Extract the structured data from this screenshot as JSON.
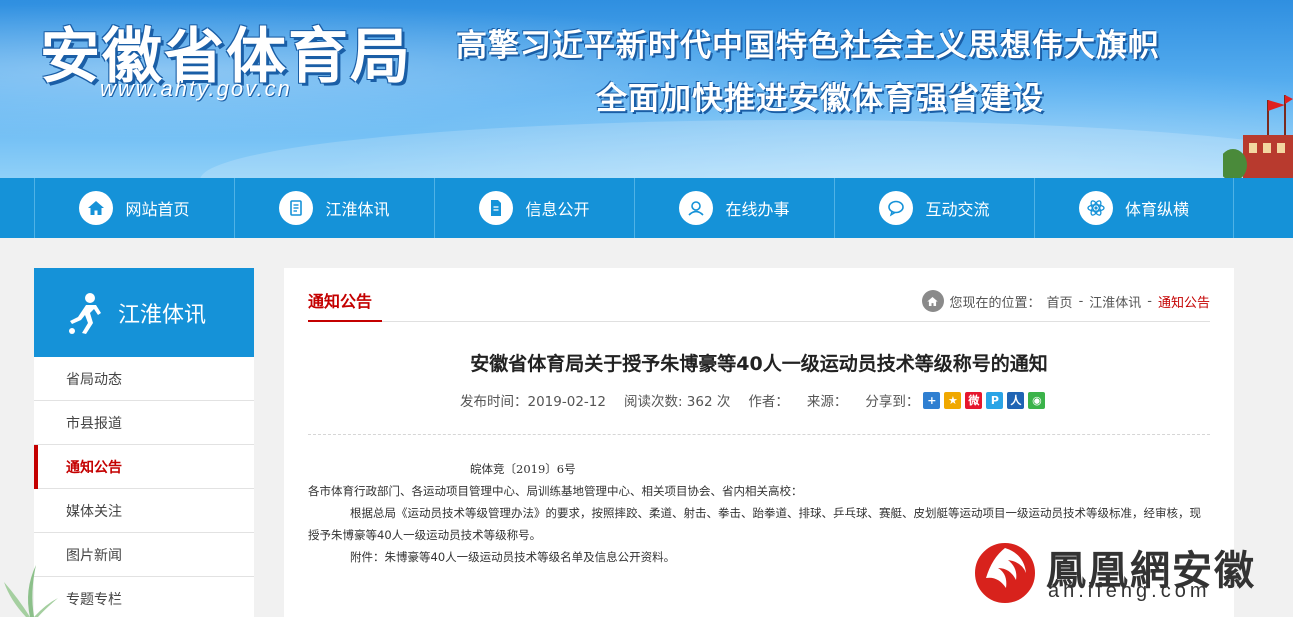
{
  "banner": {
    "site_title": "安徽省体育局",
    "site_url": "www.ahty.gov.cn",
    "slogan_line1": "高擎习近平新时代中国特色社会主义思想伟大旗帜",
    "slogan_line2": "全面加快推进安徽体育强省建设"
  },
  "nav": {
    "items": [
      {
        "label": "网站首页",
        "icon": "home-icon"
      },
      {
        "label": "江淮体讯",
        "icon": "document-icon"
      },
      {
        "label": "信息公开",
        "icon": "file-icon"
      },
      {
        "label": "在线办事",
        "icon": "service-icon"
      },
      {
        "label": "互动交流",
        "icon": "chat-icon"
      },
      {
        "label": "体育纵横",
        "icon": "atom-icon"
      }
    ]
  },
  "sidebar": {
    "title": "江淮体讯",
    "items": [
      {
        "label": "省局动态"
      },
      {
        "label": "市县报道"
      },
      {
        "label": "通知公告",
        "active": true
      },
      {
        "label": "媒体关注"
      },
      {
        "label": "图片新闻"
      },
      {
        "label": "专题专栏"
      }
    ]
  },
  "main": {
    "section_title": "通知公告",
    "breadcrumb": {
      "prefix": "您现在的位置：",
      "home": "首页",
      "sep": "-",
      "level1": "江淮体讯",
      "current": "通知公告"
    },
    "article": {
      "title": "安徽省体育局关于授予朱博豪等40人一级运动员技术等级称号的通知",
      "publish_time": "发布时间：2019-02-12",
      "views": "阅读次数: 362 次",
      "author": "作者：",
      "source": "来源：",
      "share_label": "分享到：",
      "doc_number": "皖体竞〔2019〕6号",
      "recipients": "各市体育行政部门、各运动项目管理中心、局训练基地管理中心、相关项目协会、省内相关高校：",
      "paragraph1": "根据总局《运动员技术等级管理办法》的要求，按照摔跤、柔道、射击、拳击、跆拳道、排球、乒乓球、赛艇、皮划艇等运动项目一级运动员技术等级标准，经审核，现授予朱博豪等40人一级运动员技术等级称号。",
      "attachment": "附件：朱博豪等40人一级运动员技术等级名单及信息公开资料。"
    }
  },
  "share_icons": [
    {
      "name": "qzone-share-icon",
      "color": "#2f7fd1",
      "glyph": "+"
    },
    {
      "name": "qq-share-icon",
      "color": "#f0a800",
      "glyph": "★"
    },
    {
      "name": "weibo-share-icon",
      "color": "#e6162d",
      "glyph": "微"
    },
    {
      "name": "tencent-weibo-share-icon",
      "color": "#2aa4e6",
      "glyph": "P"
    },
    {
      "name": "renren-share-icon",
      "color": "#1f64b4",
      "glyph": "人"
    },
    {
      "name": "wechat-share-icon",
      "color": "#3bb34a",
      "glyph": "◉"
    }
  ],
  "watermark": {
    "cn": "鳳凰網安徽",
    "en": "ah.ifeng.com"
  }
}
